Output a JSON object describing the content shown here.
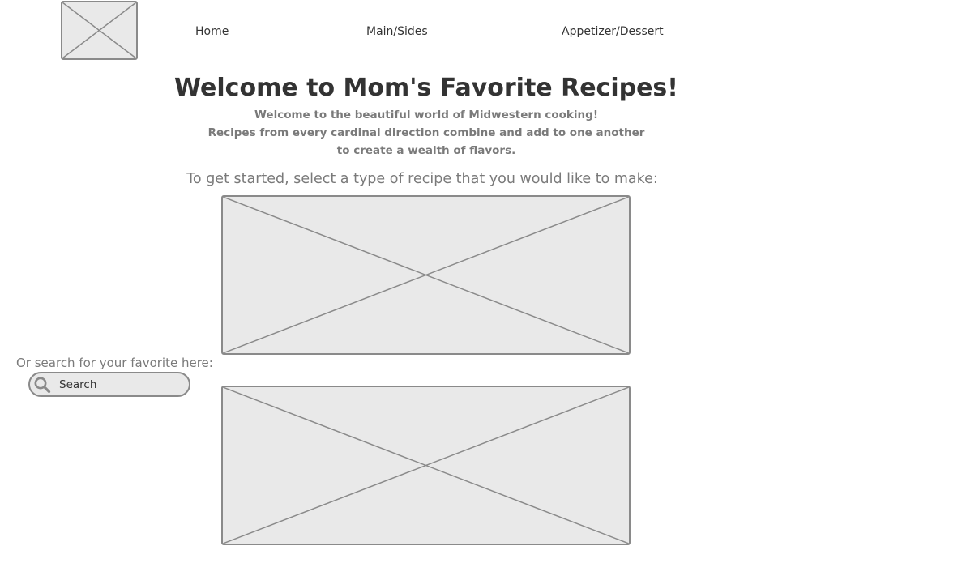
{
  "header": {
    "logo_icon": "image-placeholder-icon",
    "nav": [
      {
        "label": "Home"
      },
      {
        "label": "Main/Sides"
      },
      {
        "label": "Appetizer/Dessert"
      }
    ]
  },
  "hero": {
    "title": "Welcome to Mom's Favorite Recipes!",
    "intro_lines": [
      "Welcome to the beautiful world of Midwestern cooking!",
      "Recipes from every cardinal direction combine and add to one another",
      "to create a wealth of flavors."
    ],
    "prompt": "To get started, select a type of recipe that you would like to make:"
  },
  "search": {
    "label": "Or search for your favorite here:",
    "placeholder": "Search",
    "icon": "search-icon"
  },
  "cards": [
    {
      "icon": "image-placeholder-icon"
    },
    {
      "icon": "image-placeholder-icon"
    }
  ],
  "colors": {
    "placeholder_fill": "#e9e9e9",
    "placeholder_stroke": "#8a8a8a",
    "heading": "#333333",
    "muted_text": "#7a7a7a"
  }
}
